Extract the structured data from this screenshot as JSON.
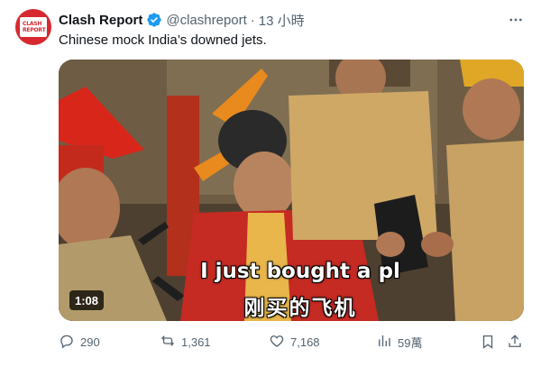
{
  "author": {
    "name": "Clash Report",
    "handle": "@clashreport",
    "separator": "·",
    "time": "13 小時",
    "avatar_text": [
      "CLASH",
      "REPORT"
    ]
  },
  "post": {
    "text": "Chinese mock India’s downed jets."
  },
  "media": {
    "subtitle_en": "I just bought a pl",
    "subtitle_zh": "刚买的飞机",
    "duration": "1:08"
  },
  "actions": {
    "replies": "290",
    "reposts": "1,361",
    "likes": "7,168",
    "views": "59萬"
  },
  "colors": {
    "accent": "#1d9bf0",
    "secondary_text": "#536471",
    "avatar_bg": "#d7282f"
  },
  "icons": [
    "verified-badge-icon",
    "more-icon",
    "reply-icon",
    "repost-icon",
    "like-icon",
    "views-icon",
    "bookmark-icon",
    "share-icon"
  ]
}
